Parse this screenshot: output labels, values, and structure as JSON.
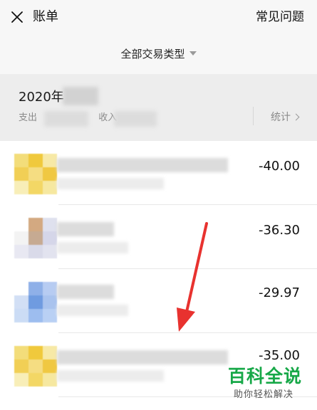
{
  "header": {
    "title": "账单",
    "faq_label": "常见问题",
    "close_icon": "close-icon"
  },
  "filter": {
    "label": "全部交易类型",
    "icon": "caret-down-icon"
  },
  "month_summary": {
    "month": "2020年",
    "expense_label": "支出",
    "income_label": "收入",
    "stats_label": "统计",
    "stats_icon": "chevron-right-icon"
  },
  "transactions": [
    {
      "amount": "-40.00",
      "avatar_colors": [
        "#f3dd7a",
        "#f0c93c",
        "#f7e9a6",
        "#f1cf55",
        "#f5dd82",
        "#f0c842",
        "#f8eeb8",
        "#f3d765",
        "#f6e8a0"
      ]
    },
    {
      "amount": "-36.30",
      "avatar_colors": [
        "#ffffff",
        "#d3a981",
        "#dfe1ee",
        "#f3f3f3",
        "#c6aa92",
        "#d5d6e9",
        "#e8e8f2",
        "#d9dae9",
        "#e2e3ef"
      ]
    },
    {
      "amount": "-29.97",
      "avatar_colors": [
        "#ffffff",
        "#8fb0e8",
        "#b7ccf2",
        "#d2dff5",
        "#6f9be0",
        "#a9c3ee",
        "#cbdcf5",
        "#9dbdef",
        "#b9d0f4"
      ]
    },
    {
      "amount": "-35.00",
      "avatar_colors": [
        "#f3dd7a",
        "#f0c93c",
        "#f7e9a6",
        "#f1cf55",
        "#f5dd82",
        "#f0c842",
        "#f8eeb8",
        "#f3d765",
        "#f6e8a0"
      ]
    }
  ],
  "watermark": {
    "title": "百科全说",
    "subtitle": "助你轻松解决"
  },
  "colors": {
    "background": "#ededed",
    "watermark_green": "#17a848",
    "annotation_red": "#e8322f"
  }
}
